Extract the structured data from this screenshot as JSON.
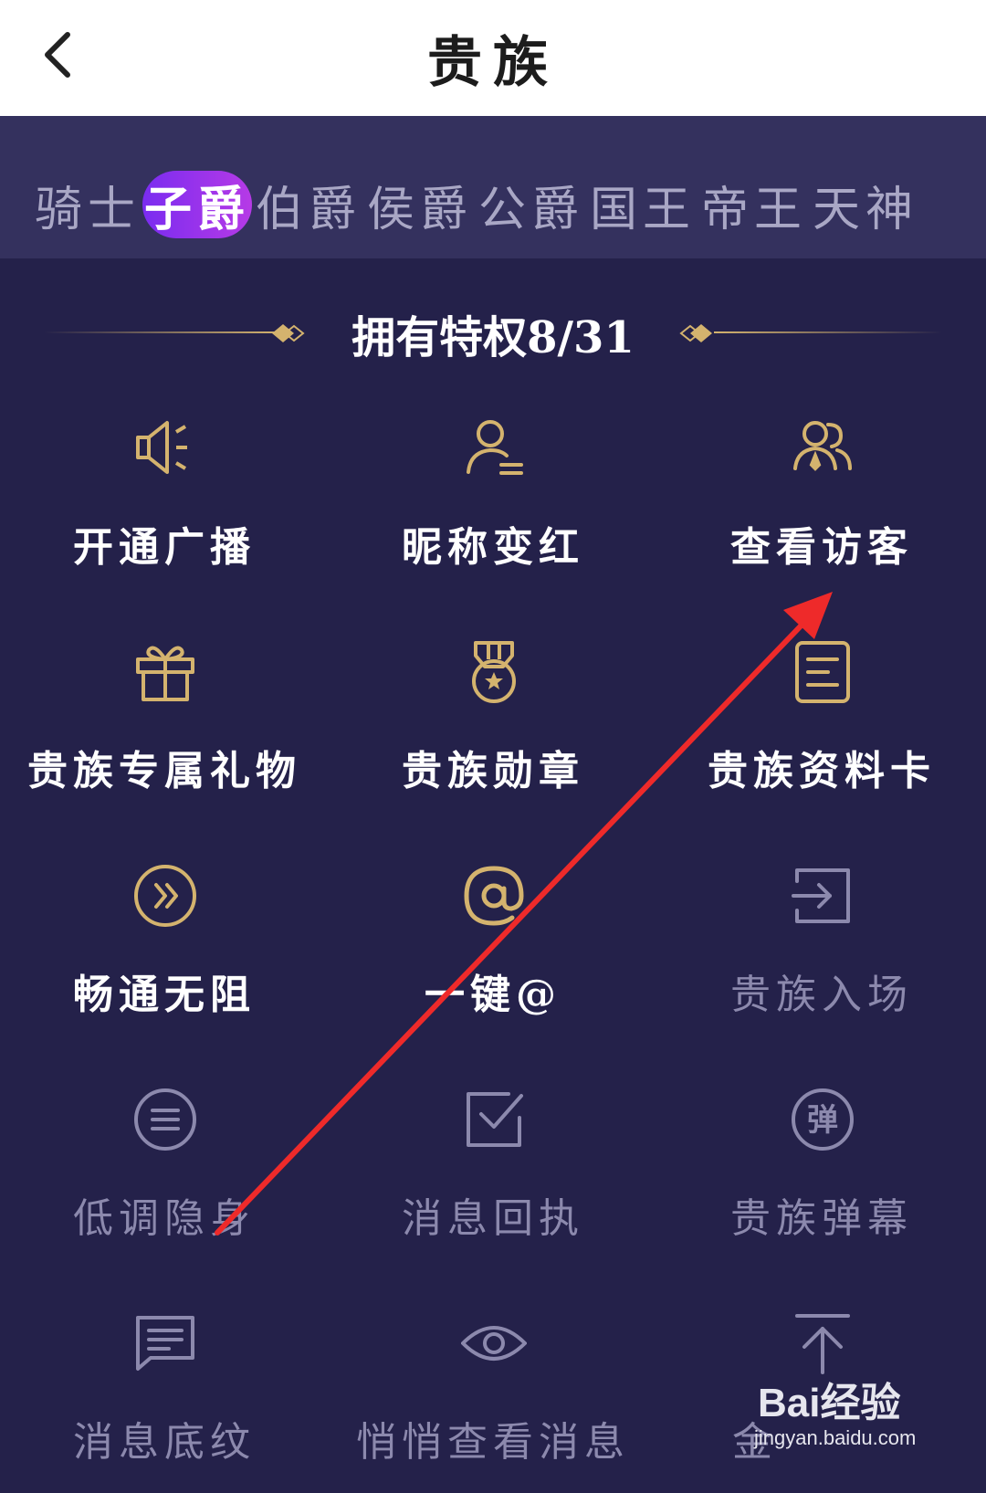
{
  "header": {
    "title": "贵族",
    "back_icon": "chevron-left-icon"
  },
  "levels": [
    "骑士",
    "子爵",
    "伯爵",
    "侯爵",
    "公爵",
    "国王",
    "帝王",
    "天神"
  ],
  "active_level": "子爵",
  "privileges_heading": "拥有特权8/31",
  "privileges": [
    {
      "label": "开通广播",
      "icon": "speaker-icon",
      "owned": true
    },
    {
      "label": "昵称变红",
      "icon": "user-list-icon",
      "owned": true
    },
    {
      "label": "查看访客",
      "icon": "users-icon",
      "owned": true
    },
    {
      "label": "贵族专属礼物",
      "icon": "gift-icon",
      "owned": true
    },
    {
      "label": "贵族勋章",
      "icon": "medal-icon",
      "owned": true
    },
    {
      "label": "贵族资料卡",
      "icon": "profile-card-icon",
      "owned": true
    },
    {
      "label": "畅通无阻",
      "icon": "fast-forward-icon",
      "owned": true
    },
    {
      "label": "一键@",
      "icon": "at-icon",
      "owned": true
    },
    {
      "label": "贵族入场",
      "icon": "enter-icon",
      "owned": false
    },
    {
      "label": "低调隐身",
      "icon": "menu-circle-icon",
      "owned": false
    },
    {
      "label": "消息回执",
      "icon": "check-box-icon",
      "owned": false
    },
    {
      "label": "贵族弹幕",
      "icon": "danmaku-icon",
      "owned": false
    },
    {
      "label": "消息底纹",
      "icon": "message-icon",
      "owned": false
    },
    {
      "label": "悄悄查看消息",
      "icon": "eye-icon",
      "owned": false
    },
    {
      "label": "金",
      "icon": "arrow-up-icon",
      "owned": false
    }
  ],
  "watermark": {
    "logo": "Bai经验",
    "url": "jingyan.baidu.com"
  },
  "colors": {
    "gold": "#d4b36e",
    "bg": "#24214a",
    "level_bar": "#34315e",
    "active": "#8e31ea",
    "arrow": "#ee2a2a"
  }
}
